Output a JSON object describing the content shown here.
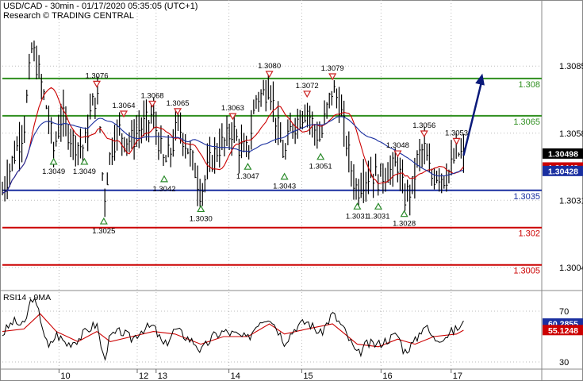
{
  "header": {
    "title": "USD/CAD - 30min - 01/17/2020 05:35:05 (UTC+1)",
    "source": "Research © TRADING CENTRAL"
  },
  "chart_data": [
    {
      "type": "candlestick",
      "ylim": [
        1.2995,
        1.3102
      ],
      "x_tick_labels": [
        "10",
        "12",
        "13",
        "14",
        "15",
        "16",
        "17"
      ],
      "y_tick_labels": [
        "1.3085",
        "1.3058",
        "1.3031",
        "1.3004"
      ],
      "price_tags": [
        {
          "label": "1.30498",
          "value": 1.30498,
          "color": "#000000"
        },
        {
          "label": "1.30442",
          "value": 1.30442,
          "color": "#cc0000"
        },
        {
          "label": "1.30428",
          "value": 1.30428,
          "color": "#1a2fa0"
        }
      ],
      "levels": [
        {
          "label": "1.308",
          "value": 1.308,
          "color": "#2f8f1f"
        },
        {
          "label": "1.3065",
          "value": 1.3065,
          "color": "#2f8f1f"
        },
        {
          "label": "1.3035",
          "value": 1.3035,
          "color": "#1a2fa0"
        },
        {
          "label": "1.302",
          "value": 1.302,
          "color": "#cc0000"
        },
        {
          "label": "1.3005",
          "value": 1.3005,
          "color": "#cc0000"
        }
      ],
      "tops": [
        {
          "label": "1.3076",
          "x": 0.175
        },
        {
          "label": "1.3064",
          "x": 0.225
        },
        {
          "label": "1.3068",
          "x": 0.278
        },
        {
          "label": "1.3065",
          "x": 0.325
        },
        {
          "label": "1.3063",
          "x": 0.427
        },
        {
          "label": "1.3080",
          "x": 0.495
        },
        {
          "label": "1.3072",
          "x": 0.565
        },
        {
          "label": "1.3079",
          "x": 0.612
        },
        {
          "label": "1.3048",
          "x": 0.733
        },
        {
          "label": "1.3056",
          "x": 0.782
        },
        {
          "label": "1.3053",
          "x": 0.842
        }
      ],
      "bottoms": [
        {
          "label": "1.3049",
          "x": 0.095
        },
        {
          "label": "1.3049",
          "x": 0.152
        },
        {
          "label": "1.3025",
          "x": 0.188
        },
        {
          "label": "1.3042",
          "x": 0.3
        },
        {
          "label": "1.3030",
          "x": 0.368
        },
        {
          "label": "1.3047",
          "x": 0.455
        },
        {
          "label": "1.3043",
          "x": 0.523
        },
        {
          "label": "1.3051",
          "x": 0.59
        },
        {
          "label": "1.3031",
          "x": 0.658
        },
        {
          "label": "1.3031",
          "x": 0.697
        },
        {
          "label": "1.3028",
          "x": 0.745
        }
      ],
      "price_path": [
        [
          0.0,
          1.3034
        ],
        [
          0.02,
          1.3048
        ],
        [
          0.04,
          1.306
        ],
        [
          0.055,
          1.3093
        ],
        [
          0.07,
          1.308
        ],
        [
          0.085,
          1.3065
        ],
        [
          0.095,
          1.3051
        ],
        [
          0.11,
          1.3065
        ],
        [
          0.13,
          1.3055
        ],
        [
          0.152,
          1.3052
        ],
        [
          0.165,
          1.3068
        ],
        [
          0.175,
          1.3074
        ],
        [
          0.182,
          1.3058
        ],
        [
          0.188,
          1.303
        ],
        [
          0.2,
          1.305
        ],
        [
          0.215,
          1.306
        ],
        [
          0.225,
          1.3056
        ],
        [
          0.24,
          1.3055
        ],
        [
          0.255,
          1.306
        ],
        [
          0.27,
          1.3062
        ],
        [
          0.278,
          1.3066
        ],
        [
          0.29,
          1.3055
        ],
        [
          0.3,
          1.3045
        ],
        [
          0.315,
          1.3052
        ],
        [
          0.325,
          1.3062
        ],
        [
          0.34,
          1.3054
        ],
        [
          0.355,
          1.3045
        ],
        [
          0.368,
          1.3034
        ],
        [
          0.385,
          1.3046
        ],
        [
          0.4,
          1.3052
        ],
        [
          0.415,
          1.3055
        ],
        [
          0.427,
          1.306
        ],
        [
          0.44,
          1.3052
        ],
        [
          0.455,
          1.305
        ],
        [
          0.47,
          1.3072
        ],
        [
          0.485,
          1.3074
        ],
        [
          0.495,
          1.3078
        ],
        [
          0.505,
          1.3066
        ],
        [
          0.515,
          1.3055
        ],
        [
          0.523,
          1.3048
        ],
        [
          0.535,
          1.306
        ],
        [
          0.55,
          1.3064
        ],
        [
          0.565,
          1.3068
        ],
        [
          0.578,
          1.306
        ],
        [
          0.59,
          1.3055
        ],
        [
          0.6,
          1.3066
        ],
        [
          0.612,
          1.3076
        ],
        [
          0.625,
          1.307
        ],
        [
          0.64,
          1.3052
        ],
        [
          0.65,
          1.304
        ],
        [
          0.658,
          1.3035
        ],
        [
          0.67,
          1.304
        ],
        [
          0.685,
          1.3042
        ],
        [
          0.697,
          1.304
        ],
        [
          0.71,
          1.3042
        ],
        [
          0.722,
          1.3043
        ],
        [
          0.733,
          1.3046
        ],
        [
          0.745,
          1.3032
        ],
        [
          0.76,
          1.3036
        ],
        [
          0.77,
          1.3048
        ],
        [
          0.782,
          1.3052
        ],
        [
          0.795,
          1.304
        ],
        [
          0.808,
          1.3042
        ],
        [
          0.82,
          1.304
        ],
        [
          0.832,
          1.3044
        ],
        [
          0.842,
          1.305
        ],
        [
          0.855,
          1.3049
        ]
      ],
      "forecast_path": [
        [
          0.855,
          1.3049
        ],
        [
          0.89,
          1.3082
        ]
      ]
    },
    {
      "type": "line",
      "title": "RSI14 - 9MA",
      "ylim": [
        25,
        85
      ],
      "y_tick_labels": [
        "70",
        "30"
      ],
      "price_tags": [
        {
          "label": "60.2855",
          "value": 60.2855,
          "color": "#1a2fa0"
        },
        {
          "label": "55.1248",
          "value": 55.1248,
          "color": "#cc0000"
        }
      ],
      "rsi_path": [
        [
          0.0,
          52
        ],
        [
          0.02,
          62
        ],
        [
          0.04,
          58
        ],
        [
          0.055,
          82
        ],
        [
          0.07,
          66
        ],
        [
          0.085,
          40
        ],
        [
          0.1,
          52
        ],
        [
          0.12,
          44
        ],
        [
          0.14,
          48
        ],
        [
          0.16,
          56
        ],
        [
          0.175,
          60
        ],
        [
          0.188,
          32
        ],
        [
          0.2,
          50
        ],
        [
          0.22,
          54
        ],
        [
          0.24,
          48
        ],
        [
          0.26,
          56
        ],
        [
          0.28,
          58
        ],
        [
          0.3,
          42
        ],
        [
          0.32,
          56
        ],
        [
          0.34,
          50
        ],
        [
          0.36,
          44
        ],
        [
          0.368,
          38
        ],
        [
          0.39,
          50
        ],
        [
          0.41,
          54
        ],
        [
          0.43,
          52
        ],
        [
          0.455,
          48
        ],
        [
          0.475,
          62
        ],
        [
          0.495,
          66
        ],
        [
          0.51,
          56
        ],
        [
          0.523,
          46
        ],
        [
          0.545,
          58
        ],
        [
          0.565,
          62
        ],
        [
          0.59,
          52
        ],
        [
          0.612,
          68
        ],
        [
          0.63,
          58
        ],
        [
          0.65,
          42
        ],
        [
          0.658,
          35
        ],
        [
          0.675,
          44
        ],
        [
          0.697,
          44
        ],
        [
          0.715,
          48
        ],
        [
          0.733,
          52
        ],
        [
          0.745,
          38
        ],
        [
          0.765,
          46
        ],
        [
          0.782,
          60
        ],
        [
          0.8,
          48
        ],
        [
          0.82,
          50
        ],
        [
          0.842,
          56
        ],
        [
          0.855,
          60
        ]
      ],
      "ma_path": [
        [
          0.0,
          54
        ],
        [
          0.04,
          56
        ],
        [
          0.07,
          68
        ],
        [
          0.1,
          54
        ],
        [
          0.14,
          46
        ],
        [
          0.175,
          54
        ],
        [
          0.2,
          46
        ],
        [
          0.24,
          50
        ],
        [
          0.28,
          54
        ],
        [
          0.32,
          52
        ],
        [
          0.368,
          44
        ],
        [
          0.41,
          50
        ],
        [
          0.455,
          50
        ],
        [
          0.495,
          60
        ],
        [
          0.523,
          52
        ],
        [
          0.565,
          56
        ],
        [
          0.612,
          60
        ],
        [
          0.658,
          44
        ],
        [
          0.697,
          42
        ],
        [
          0.733,
          48
        ],
        [
          0.765,
          44
        ],
        [
          0.8,
          50
        ],
        [
          0.842,
          52
        ],
        [
          0.855,
          55
        ]
      ]
    }
  ],
  "colors": {
    "price": "#000000",
    "ma_fast": "#cc0000",
    "ma_slow": "#1a2fa0",
    "grid": "#bbbbbb",
    "forecast": "#0a1a7a"
  }
}
